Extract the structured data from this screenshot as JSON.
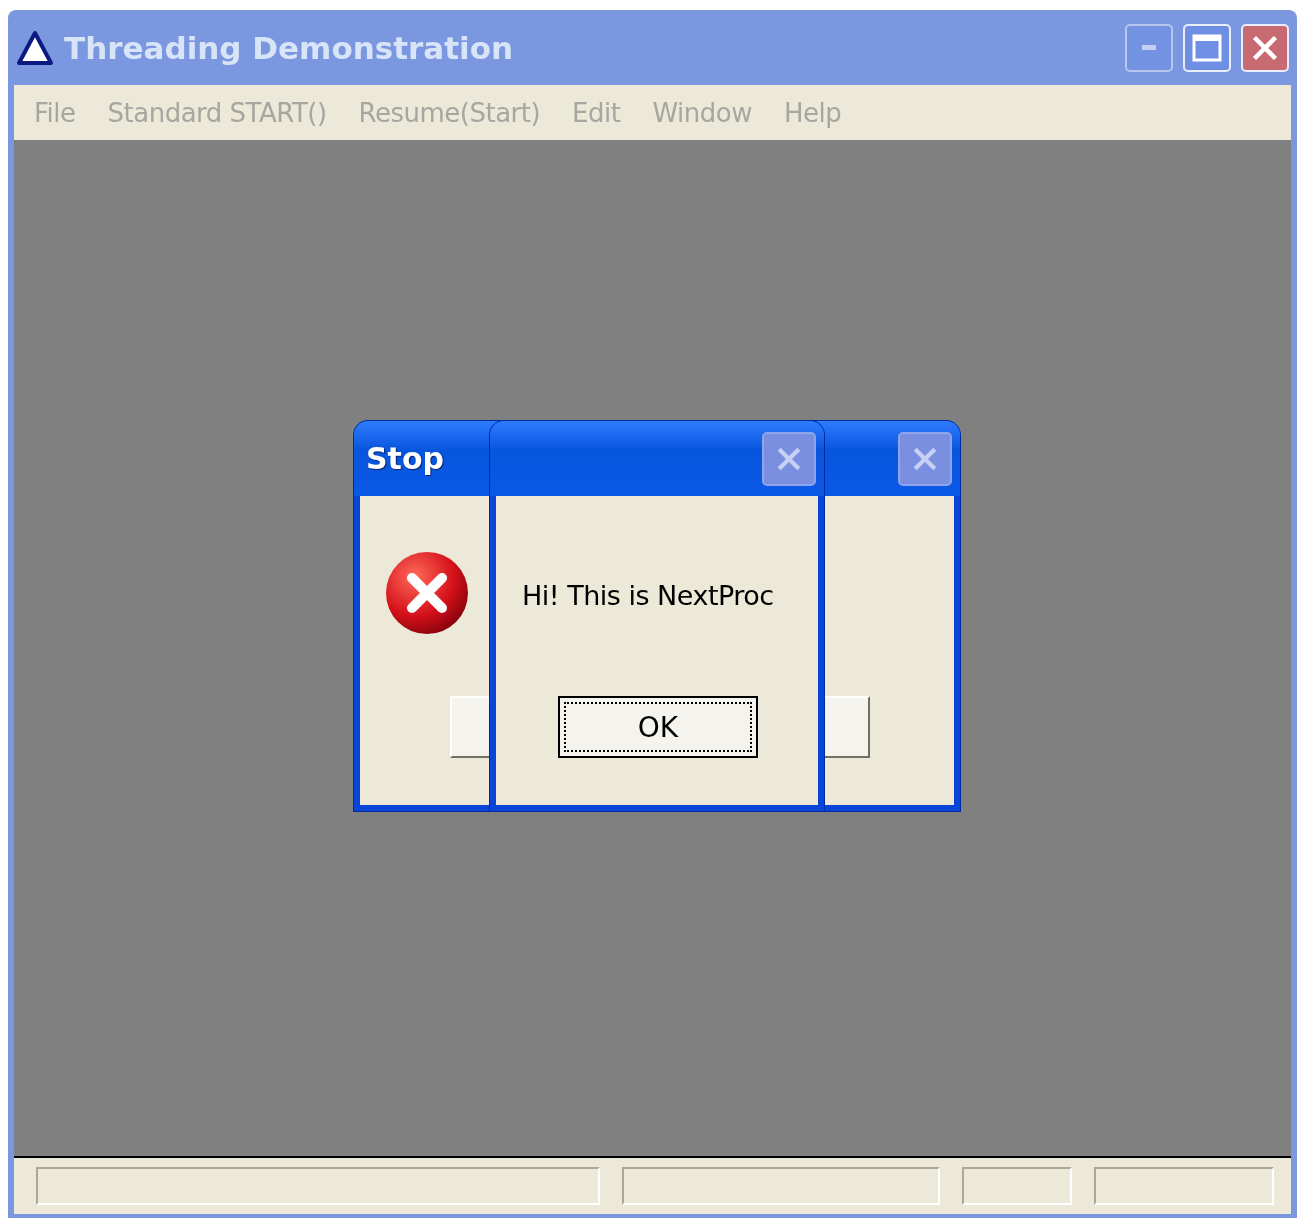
{
  "window": {
    "title": "Threading Demonstration",
    "active": false
  },
  "menu": [
    {
      "label": "File",
      "disabled": true
    },
    {
      "label": "Standard START()",
      "disabled": true
    },
    {
      "label": "Resume(Start)",
      "disabled": true
    },
    {
      "label": "Edit",
      "disabled": true
    },
    {
      "label": "Window",
      "disabled": true
    },
    {
      "label": "Help",
      "disabled": true
    }
  ],
  "dialogs": [
    {
      "title": "Stop",
      "kind": "error"
    },
    {
      "message": "Hi! This is NextProc",
      "button": {
        "label": "OK",
        "focused": true
      }
    }
  ]
}
